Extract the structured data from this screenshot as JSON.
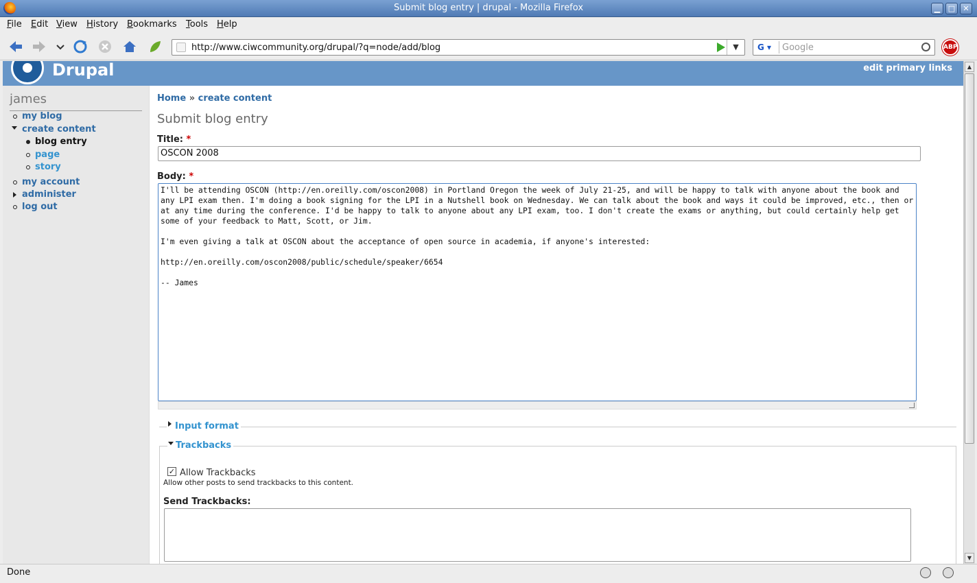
{
  "window": {
    "title": "Submit blog entry | drupal - Mozilla Firefox",
    "buttons": {
      "minimize": "▁",
      "maximize": "□",
      "close": "✕"
    }
  },
  "menu": [
    "File",
    "Edit",
    "View",
    "History",
    "Bookmarks",
    "Tools",
    "Help"
  ],
  "toolbar": {
    "url": "http://www.ciwcommunity.org/drupal/?q=node/add/blog",
    "search_placeholder": "Google",
    "search_engine": "G",
    "abp_label": "ABP"
  },
  "site": {
    "name": "Drupal",
    "primary_links": "edit primary links"
  },
  "sidebar": {
    "username": "james",
    "items": [
      {
        "label": "my blog"
      },
      {
        "label": "create content"
      },
      {
        "label": "blog entry"
      },
      {
        "label": "page"
      },
      {
        "label": "story"
      },
      {
        "label": "my account"
      },
      {
        "label": "administer"
      },
      {
        "label": "log out"
      }
    ]
  },
  "main": {
    "breadcrumb": {
      "home": "Home",
      "sep": "»",
      "current": "create content"
    },
    "page_title": "Submit blog entry",
    "title_label": "Title:",
    "title_value": "OSCON 2008",
    "body_label": "Body:",
    "required_mark": "*",
    "body_value": "I'll be attending OSCON (http://en.oreilly.com/oscon2008) in Portland Oregon the week of July 21-25, and will be happy to talk with anyone about the book and any LPI exam then. I'm doing a book signing for the LPI in a Nutshell book on Wednesday. We can talk about the book and ways it could be improved, etc., then or at any time during the conference. I'd be happy to talk to anyone about any LPI exam, too. I don't create the exams or anything, but could certainly help get some of your feedback to Matt, Scott, or Jim.\n\nI'm even giving a talk at OSCON about the acceptance of open source in academia, if anyone's interested:\n\nhttp://en.oreilly.com/oscon2008/public/schedule/speaker/6654\n\n-- James",
    "input_format_legend": "Input format",
    "trackbacks_legend": "Trackbacks",
    "allow_trackbacks_label": "Allow Trackbacks",
    "allow_trackbacks_checked": true,
    "allow_trackbacks_desc": "Allow other posts to send trackbacks to this content.",
    "send_trackbacks_label": "Send Trackbacks:",
    "send_trackbacks_value": ""
  },
  "status": {
    "text": "Done"
  },
  "colors": {
    "header": "#6796c8",
    "link": "#2f6ba5",
    "link_light": "#3393cf",
    "required": "#cc0000"
  }
}
